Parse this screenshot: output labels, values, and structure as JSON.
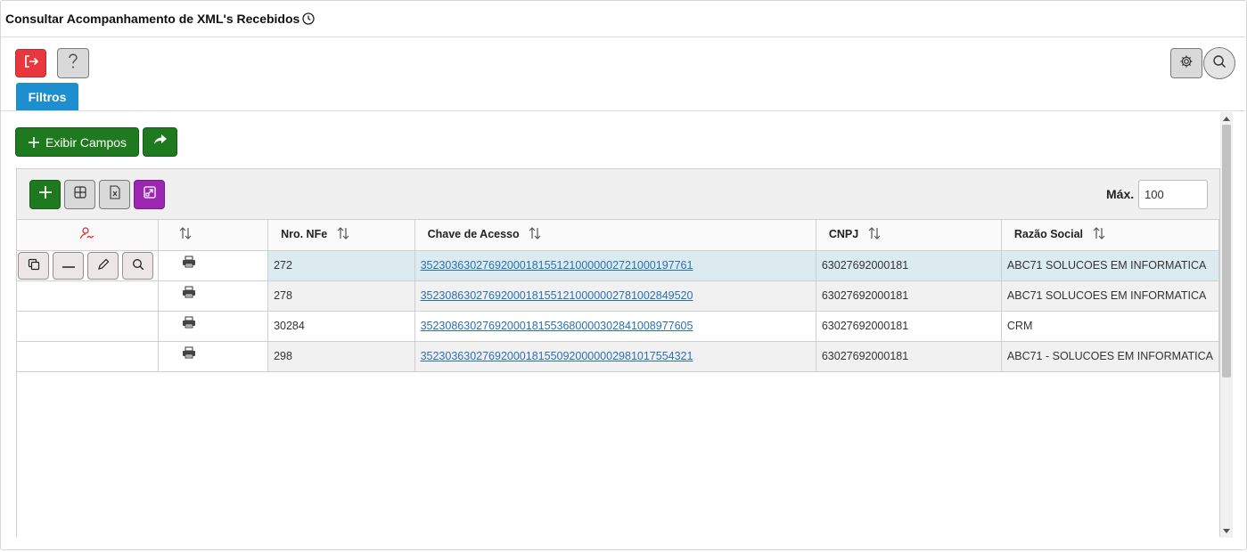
{
  "header": {
    "title": "Consultar Acompanhamento de XML's Recebidos"
  },
  "toolbar": {
    "filtros_label": "Filtros"
  },
  "actions": {
    "exibir_campos_label": "Exibir Campos"
  },
  "grid": {
    "max_label": "Máx.",
    "max_value": "100",
    "columns": [
      "",
      "",
      "Nro. NFe",
      "Chave de Acesso",
      "CNPJ",
      "Razão Social"
    ],
    "rows": [
      {
        "nro": "272",
        "chave": "35230363027692000181551210000002721000197761",
        "cnpj": "63027692000181",
        "razao": "ABC71 SOLUCOES EM INFORMATICA"
      },
      {
        "nro": "278",
        "chave": "35230863027692000181551210000002781002849520",
        "cnpj": "63027692000181",
        "razao": "ABC71 SOLUCOES EM INFORMATICA"
      },
      {
        "nro": "30284",
        "chave": "35230863027692000181553680000302841008977605",
        "cnpj": "63027692000181",
        "razao": "CRM"
      },
      {
        "nro": "298",
        "chave": "35230363027692000181550920000002981017554321",
        "cnpj": "63027692000181",
        "razao": "ABC71 - SOLUCOES EM INFORMATICA"
      }
    ]
  },
  "colors": {
    "filtros_blue": "#1e8fce",
    "green": "#1f7a1f",
    "red": "#e8383d",
    "purple": "#9b27b0",
    "link": "#2a6fb5",
    "selected_row": "#dcebf0"
  }
}
